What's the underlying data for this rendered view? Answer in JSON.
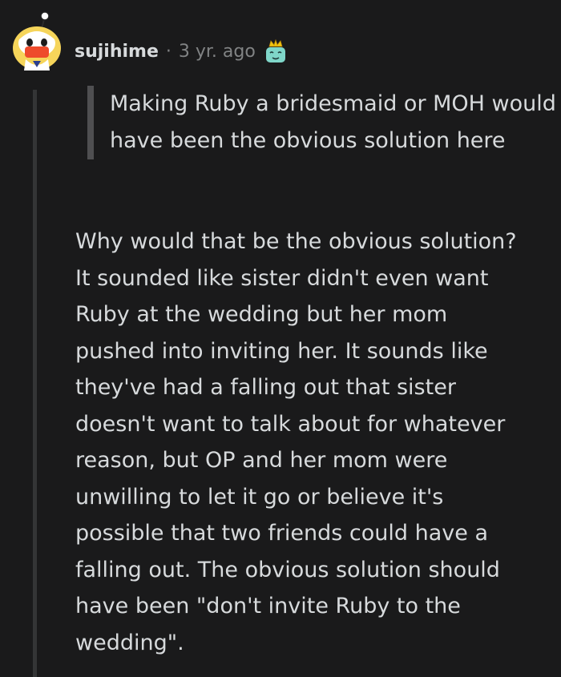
{
  "comment": {
    "username": "sujihime",
    "separator": "·",
    "timestamp": "3 yr. ago",
    "avatar_icon": "snoo-avatar-icon",
    "award_icon": "crowned-award-icon",
    "quote": "Making Ruby a bridesmaid or MOH would have been the obvious solution here",
    "body": "Why would that be the obvious solution?\nIt sounded like sister didn't even want\nRuby at the wedding but her mom\npushed into inviting her. It sounds like\nthey've had a falling out that sister\ndoesn't want to talk about for whatever\nreason, but OP and her mom were\nunwilling to let it go or believe it's\npossible that two friends could have a\nfalling out. The obvious solution should\nhave been \"don't invite Ruby to the\nwedding\"."
  },
  "colors": {
    "background": "#1a1a1b",
    "text": "#d7dadc",
    "meta": "#818384",
    "thread_line": "#343536",
    "quote_bar": "#4f4f51"
  }
}
